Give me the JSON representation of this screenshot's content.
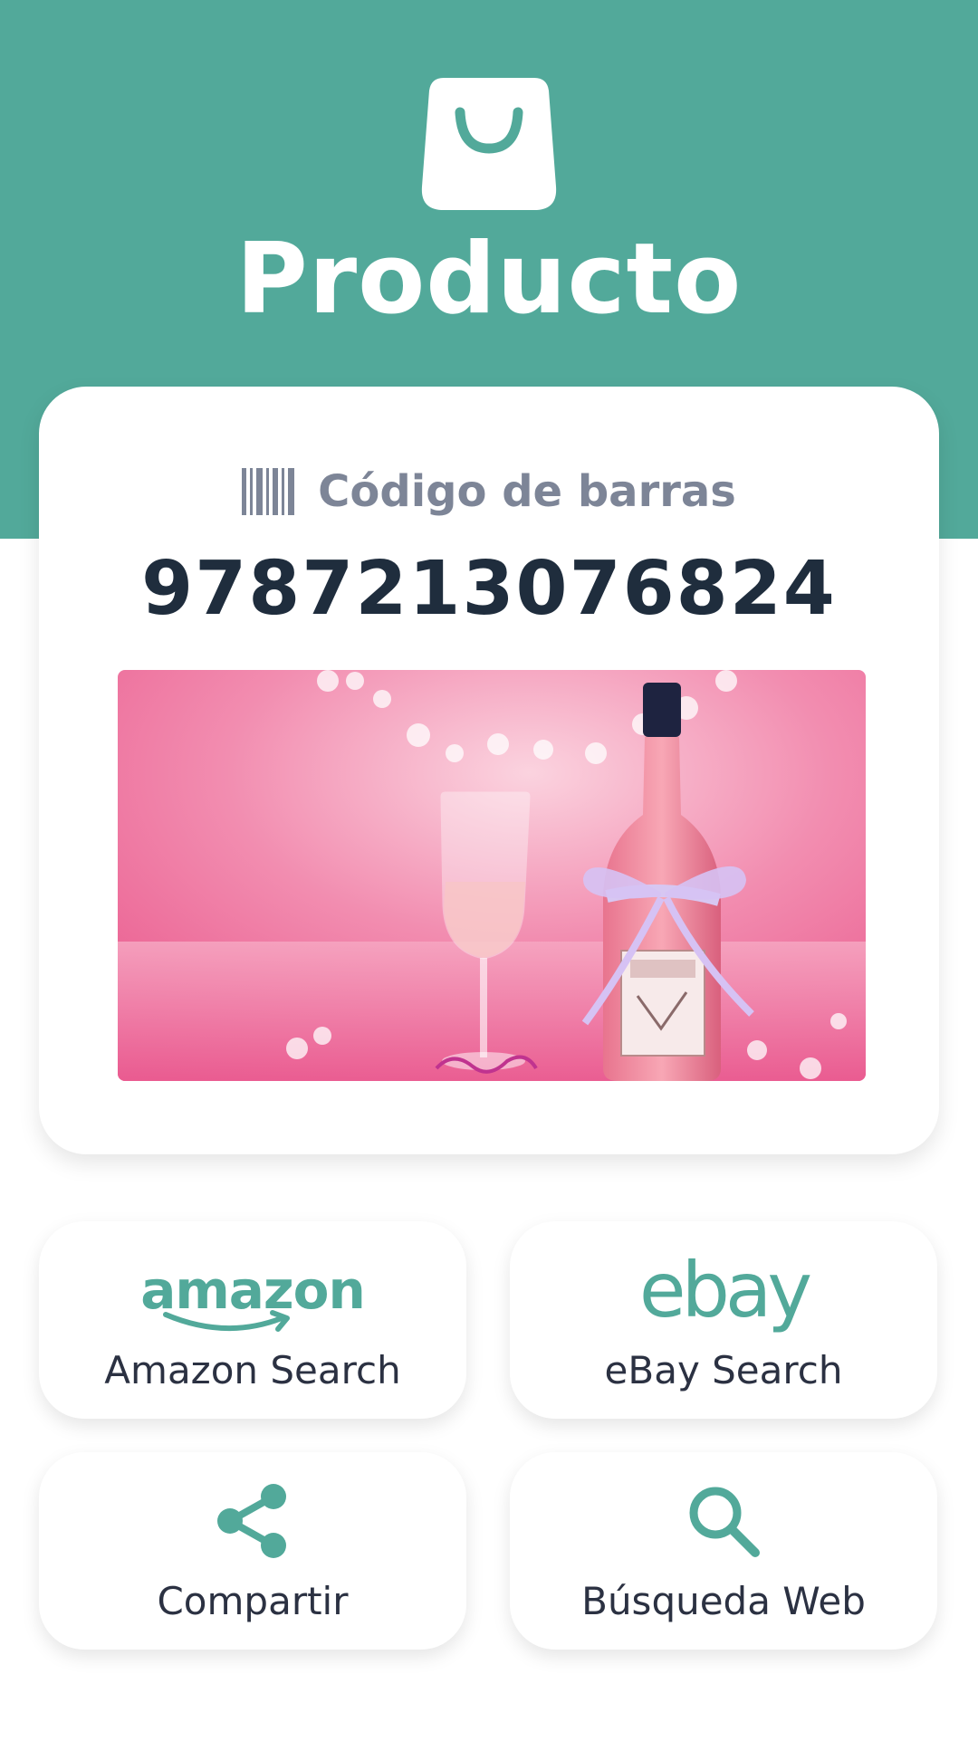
{
  "header": {
    "title": "Producto",
    "bag_icon": "shopping-bag-icon",
    "background_color": "#52a99a"
  },
  "product_card": {
    "barcode_icon": "barcode-icon",
    "barcode_label": "Código de barras",
    "barcode_value": "9787213076824",
    "image_description_icon": "product-photo"
  },
  "actions": {
    "amazon": {
      "logo_text": "amazon",
      "label": "Amazon Search",
      "icon": "amazon-logo-icon"
    },
    "ebay": {
      "logo_text": "ebay",
      "label": "eBay Search",
      "icon": "ebay-logo-icon"
    },
    "share": {
      "label": "Compartir",
      "icon": "share-icon"
    },
    "web": {
      "label": "Búsqueda Web",
      "icon": "search-icon"
    }
  },
  "colors": {
    "accent": "#52a99a",
    "text_dark": "#1f2d3d",
    "text_muted": "#7d8597"
  }
}
